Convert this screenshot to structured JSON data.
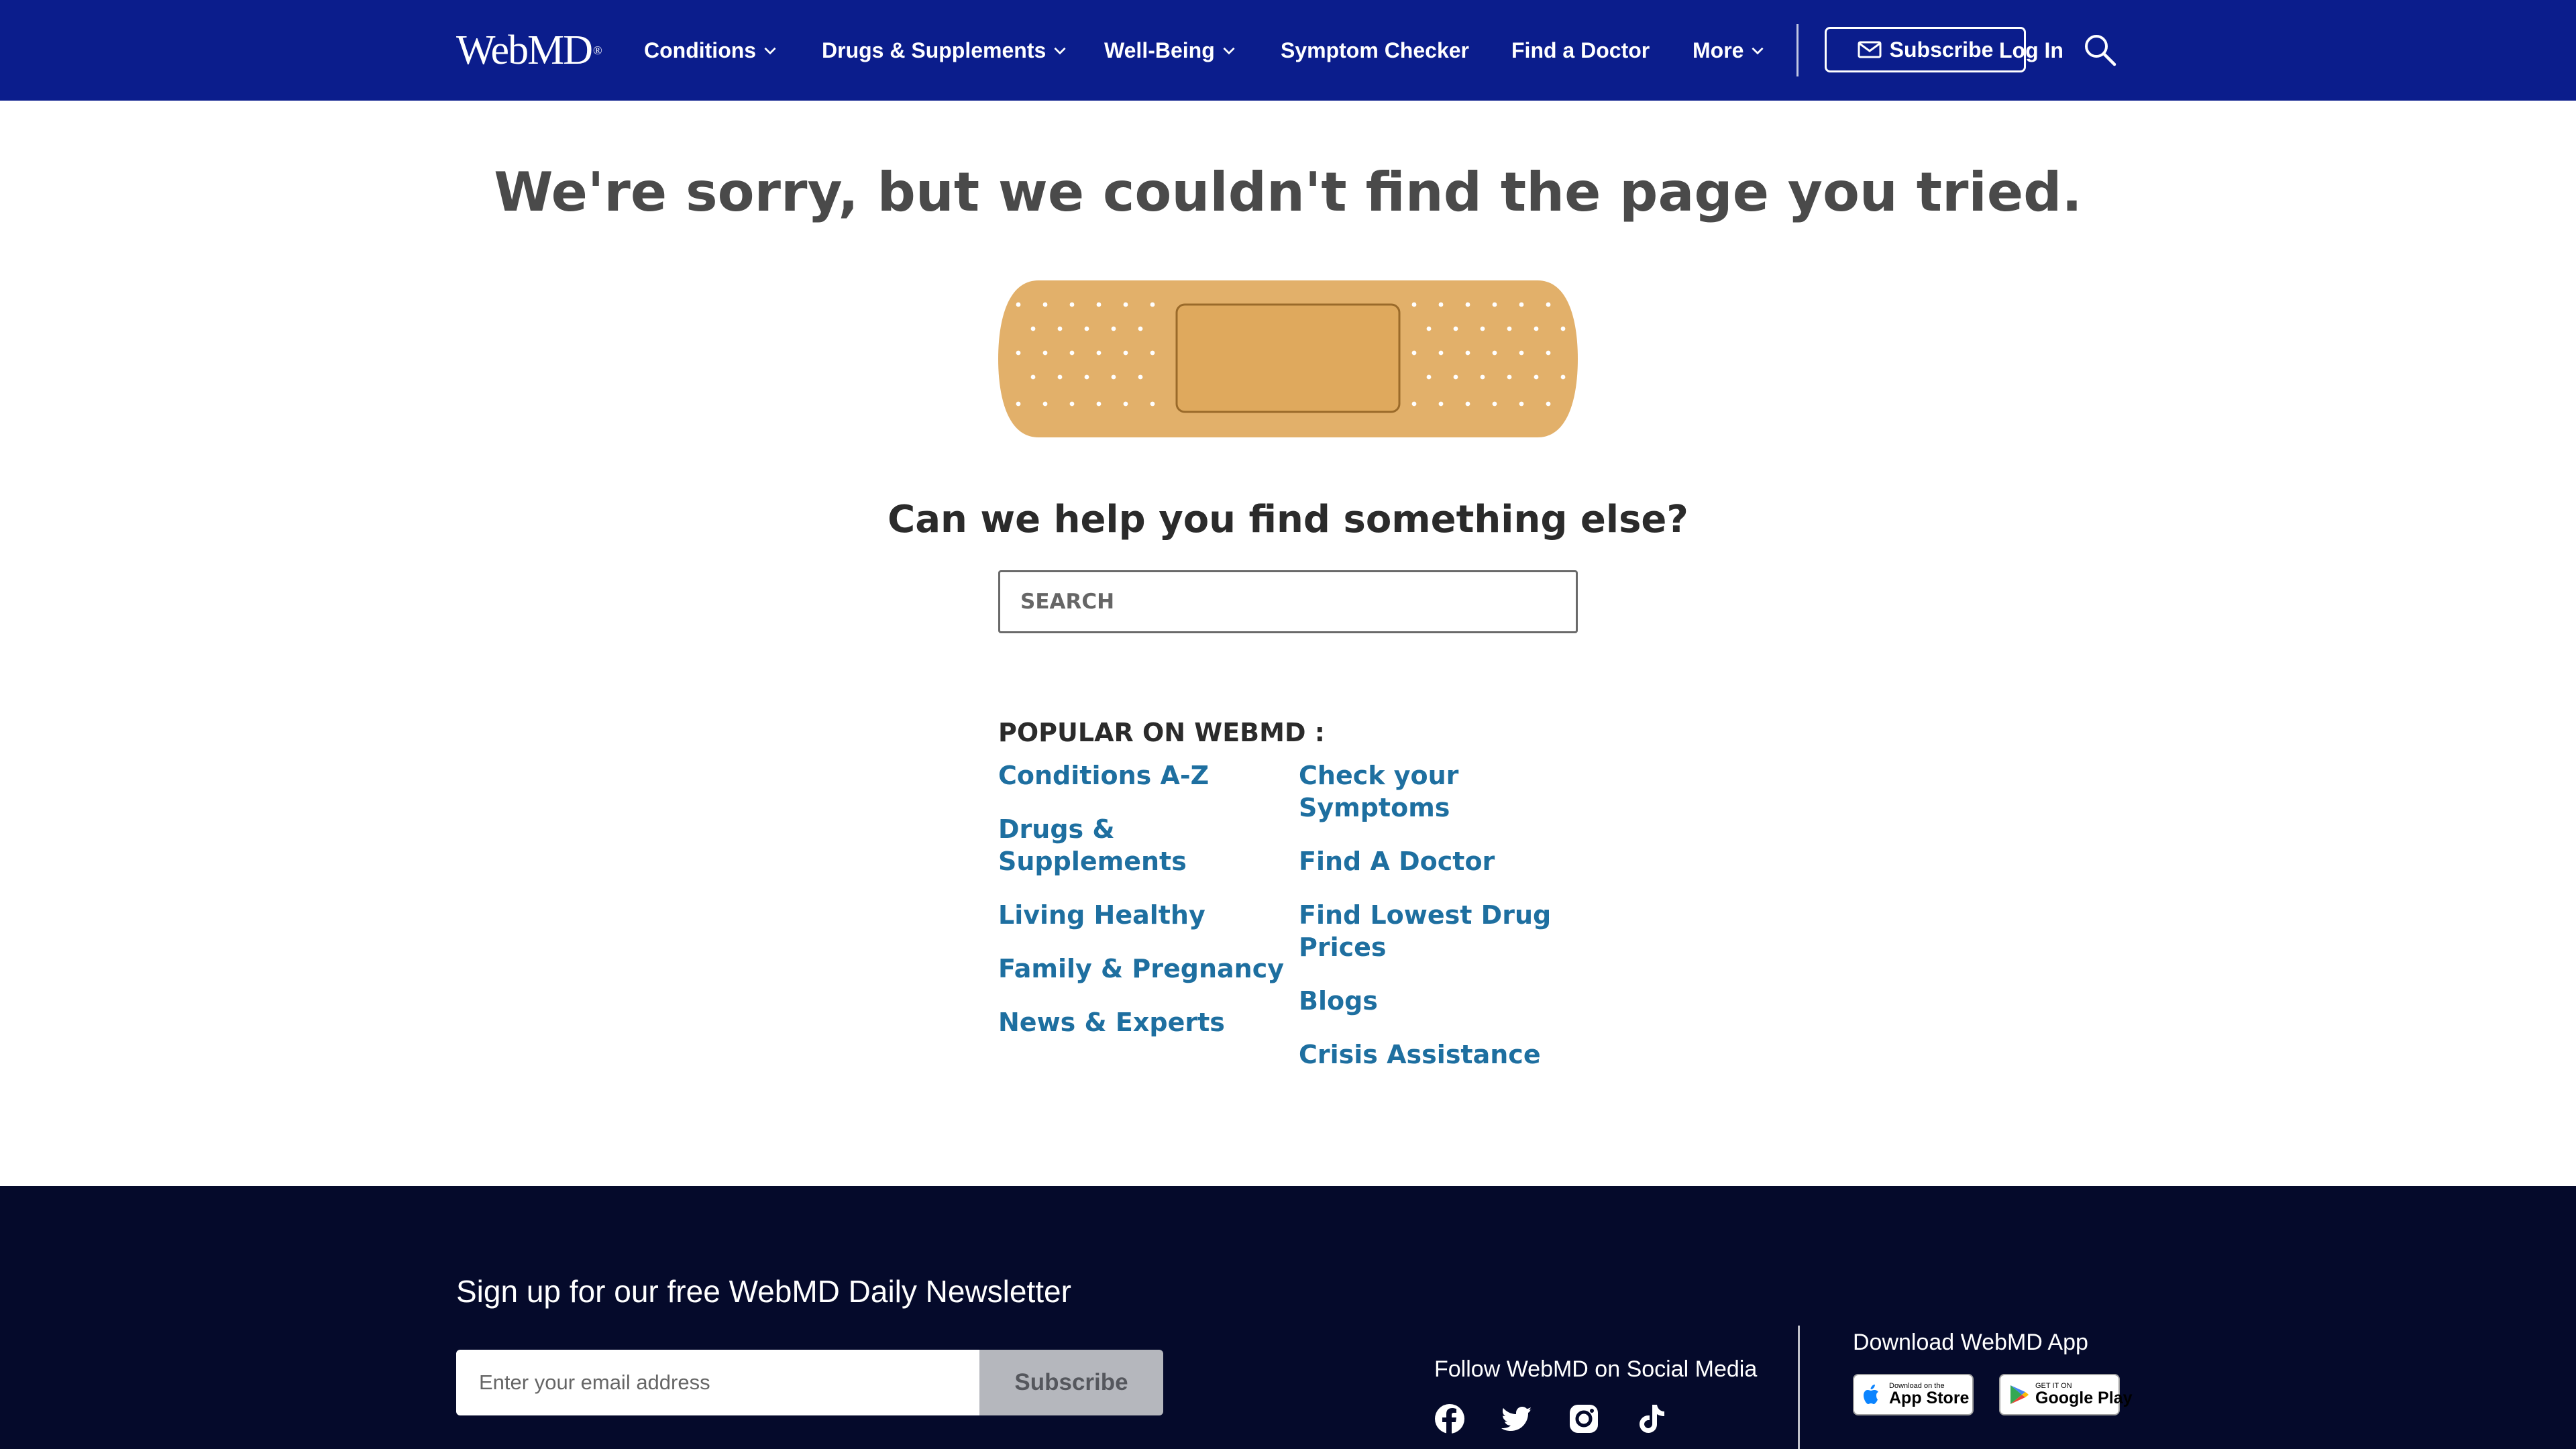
{
  "header": {
    "logo": "WebMD",
    "logo_mark": "®",
    "nav": [
      {
        "label": "Conditions",
        "has_dropdown": true
      },
      {
        "label": "Drugs & Supplements",
        "has_dropdown": true
      },
      {
        "label": "Well-Being",
        "has_dropdown": true
      },
      {
        "label": "Symptom Checker",
        "has_dropdown": false
      },
      {
        "label": "Find a Doctor",
        "has_dropdown": false
      },
      {
        "label": "More",
        "has_dropdown": true
      }
    ],
    "subscribe_label": "Subscribe",
    "login_label": "Log In",
    "search_icon": "search-icon"
  },
  "main": {
    "error_title": "We're sorry, but we couldn't find the page you tried.",
    "illustration": "bandage-illustration",
    "help_title": "Can we help you find something else?",
    "search_placeholder": "SEARCH",
    "popular_heading": "POPULAR ON WEBMD :",
    "popular_left": [
      "Conditions A-Z",
      "Drugs & Supplements",
      "Living Healthy",
      "Family & Pregnancy",
      "News & Experts"
    ],
    "popular_right": [
      "Check your Symptoms",
      "Find A Doctor",
      "Find Lowest Drug Prices",
      "Blogs",
      "Crisis Assistance"
    ]
  },
  "footer": {
    "newsletter_title": "Sign up for our free WebMD Daily Newsletter",
    "email_placeholder": "Enter your email address",
    "email_button": "Subscribe",
    "social_title": "Follow WebMD on Social Media",
    "social_icons": [
      "facebook-icon",
      "twitter-icon",
      "instagram-icon",
      "tiktok-icon"
    ],
    "app_title": "Download WebMD App",
    "app_store_small": "Download on the",
    "app_store_big": "App Store",
    "google_play_small": "GET IT ON",
    "google_play_big": "Google Play"
  },
  "colors": {
    "header_bg": "#0b1d8c",
    "footer_bg": "#050a2b",
    "link": "#1e6fa0",
    "bandage": "#e2b06a"
  }
}
